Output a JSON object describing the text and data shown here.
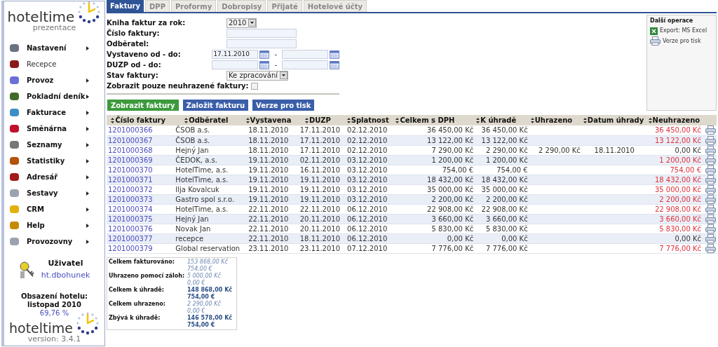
{
  "sidebar": {
    "logo": {
      "brand": "hoteltime",
      "subtitle": "prezentace"
    },
    "items": [
      {
        "label": "Nastavení",
        "submenu": true
      },
      {
        "label": "Recepce",
        "submenu": false
      },
      {
        "label": "Provoz",
        "submenu": true
      },
      {
        "label": "Pokladní deník",
        "submenu": true
      },
      {
        "label": "Fakturace",
        "submenu": true
      },
      {
        "label": "Směnárna",
        "submenu": true
      },
      {
        "label": "Seznamy",
        "submenu": true
      },
      {
        "label": "Statistiky",
        "submenu": true
      },
      {
        "label": "Adresář",
        "submenu": true
      },
      {
        "label": "Sestavy",
        "submenu": true
      },
      {
        "label": "CRM",
        "submenu": true
      },
      {
        "label": "Help",
        "submenu": true
      },
      {
        "label": "Provozovny",
        "submenu": true
      }
    ],
    "user": {
      "title": "Uživatel",
      "name": "ht.dbohunek"
    },
    "occupancy": {
      "title": "Obsazení hotelu:",
      "period": "listopad 2010",
      "value": "69,76 %"
    },
    "footer": {
      "brand": "hoteltime",
      "version": "version: 3.4.1"
    }
  },
  "tabs": [
    {
      "label": "Faktury",
      "selected": true
    },
    {
      "label": "DPP",
      "selected": false
    },
    {
      "label": "Proformy",
      "selected": false
    },
    {
      "label": "Dobropisy",
      "selected": false
    },
    {
      "label": "Přijaté",
      "selected": false
    },
    {
      "label": "Hotelové účty",
      "selected": false
    }
  ],
  "filters": [
    {
      "kind": "select",
      "label": "Kniha faktur za rok:",
      "value": "2010"
    },
    {
      "kind": "text",
      "label": "Číslo faktury:"
    },
    {
      "kind": "text",
      "label": "Odběratel:"
    },
    {
      "kind": "daterange",
      "label": "Vystaveno od - do:",
      "from": "17.11.2010",
      "separator": "-"
    },
    {
      "kind": "daterange",
      "label": "DUZP od - do:",
      "separator": "-"
    },
    {
      "kind": "select",
      "label": "Stav faktury:",
      "value": "Ke zpracování"
    },
    {
      "kind": "checkbox",
      "label": "Zobrazit pouze neuhrazené faktury:",
      "checked": false
    }
  ],
  "buttons": [
    {
      "label": "Zobrazit faktury",
      "primary": true
    },
    {
      "label": "Založit fakturu",
      "primary": false
    },
    {
      "label": "Verze pro tisk",
      "primary": false
    }
  ],
  "operations": {
    "title": "Další operace",
    "items": [
      {
        "kind": "excel",
        "label": "Export: MS Excel"
      },
      {
        "kind": "print",
        "label": "Verze pro tisk"
      }
    ]
  },
  "table": {
    "columns": [
      "Číslo faktury",
      "Odběratel",
      "Vystavena",
      "DUZP",
      "Splatnost",
      "Celkem s DPH",
      "K úhradě",
      "Uhrazeno",
      "Datum úhrady",
      "Neuhrazeno"
    ],
    "rows": [
      {
        "cells": [
          "1201000366",
          "ČSOB a.s.",
          "18.11.2010",
          "17.11.2010",
          "02.12.2010",
          "36 450,00 Kč",
          "36 450,00 Kč",
          "",
          "",
          "36 450,00 Kč"
        ],
        "outstanding": true
      },
      {
        "cells": [
          "1201000367",
          "ČSOB a.s.",
          "18.11.2010",
          "17.11.2010",
          "02.12.2010",
          "13 122,00 Kč",
          "13 122,00 Kč",
          "",
          "",
          "13 122,00 Kč"
        ],
        "outstanding": true
      },
      {
        "cells": [
          "1201000368",
          "Hejný Jan",
          "18.11.2010",
          "17.11.2010",
          "02.12.2010",
          "7 290,00 Kč",
          "2 290,00 Kč",
          "2 290,00 Kč",
          "18.11.2010",
          "0,00 Kč"
        ],
        "outstanding": false
      },
      {
        "cells": [
          "1201000369",
          "ČEDOK, a.s.",
          "19.11.2010",
          "02.11.2010",
          "03.12.2010",
          "1 200,00 Kč",
          "1 200,00 Kč",
          "",
          "",
          "1 200,00 Kč"
        ],
        "outstanding": true
      },
      {
        "cells": [
          "1201000370",
          "HotelTime, a.s.",
          "19.11.2010",
          "16.11.2010",
          "03.12.2010",
          "754,00 €",
          "754,00 €",
          "",
          "",
          "754,00 €"
        ],
        "outstanding": true
      },
      {
        "cells": [
          "1201000371",
          "HotelTime, a.s.",
          "19.11.2010",
          "19.11.2010",
          "03.12.2010",
          "18 432,00 Kč",
          "18 432,00 Kč",
          "",
          "",
          "18 432,00 Kč"
        ],
        "outstanding": true
      },
      {
        "cells": [
          "1201000372",
          "Ilja Kovalcuk",
          "19.11.2010",
          "19.11.2010",
          "03.12.2010",
          "35 000,00 Kč",
          "35 000,00 Kč",
          "",
          "",
          "35 000,00 Kč"
        ],
        "outstanding": true
      },
      {
        "cells": [
          "1201000373",
          "Gastro spol s.r.o.",
          "19.11.2010",
          "19.11.2010",
          "03.12.2010",
          "2 200,00 Kč",
          "2 200,00 Kč",
          "",
          "",
          "2 200,00 Kč"
        ],
        "outstanding": true
      },
      {
        "cells": [
          "1201000374",
          "HotelTime, a.s.",
          "22.11.2010",
          "22.11.2010",
          "06.12.2010",
          "22 908,00 Kč",
          "22 908,00 Kč",
          "",
          "",
          "22 908,00 Kč"
        ],
        "outstanding": true
      },
      {
        "cells": [
          "1201000375",
          "Hejný Jan",
          "22.11.2010",
          "20.11.2010",
          "06.12.2010",
          "3 660,00 Kč",
          "3 660,00 Kč",
          "",
          "",
          "3 660,00 Kč"
        ],
        "outstanding": true
      },
      {
        "cells": [
          "1201000376",
          "Novak Jan",
          "22.11.2010",
          "20.11.2010",
          "06.12.2010",
          "5 830,00 Kč",
          "5 830,00 Kč",
          "",
          "",
          "5 830,00 Kč"
        ],
        "outstanding": true
      },
      {
        "cells": [
          "1201000377",
          "recepce",
          "22.11.2010",
          "18.11.2010",
          "06.12.2010",
          "0,00 Kč",
          "0,00 Kč",
          "",
          "",
          "0,00 Kč"
        ],
        "outstanding": false
      },
      {
        "cells": [
          "1201000379",
          "Global reservation",
          "23.11.2010",
          "23.11.2010",
          "07.12.2010",
          "7 776,00 Kč",
          "7 776,00 Kč",
          "",
          "",
          "7 776,00 Kč"
        ],
        "outstanding": true
      }
    ]
  },
  "summary": [
    {
      "label": "Celkem fakturováno:",
      "values": [
        "153 868,00 Kč",
        "754,00 €"
      ],
      "emphasis": false
    },
    {
      "label": "Uhrazeno pomocí záloh:",
      "values": [
        "5 000,00 Kč",
        "0,00 €"
      ],
      "emphasis": false
    },
    {
      "label": "Celkem k úhradě:",
      "values": [
        "148 868,00 Kč",
        "754,00 €"
      ],
      "emphasis": true
    },
    {
      "label": "Celkem uhrazeno:",
      "values": [
        "2 290,00 Kč",
        "0,00 €"
      ],
      "emphasis": false
    },
    {
      "label": "Zbývá k úhradě:",
      "values": [
        "146 578,00 Kč",
        "754,00 €"
      ],
      "emphasis": true
    }
  ]
}
